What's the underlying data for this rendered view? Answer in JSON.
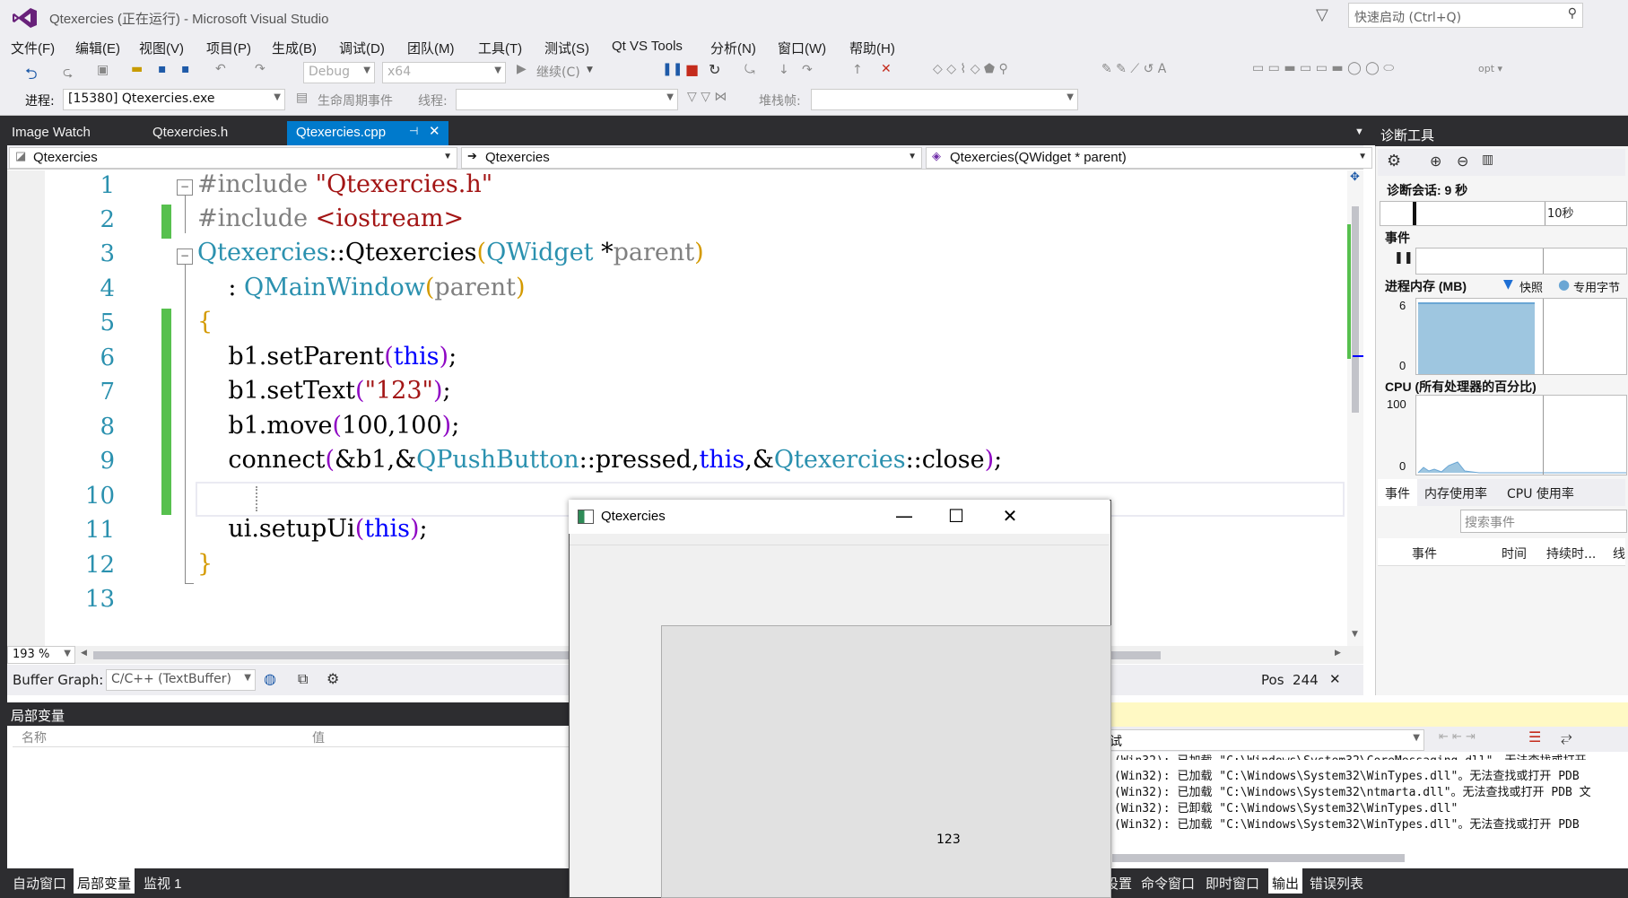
{
  "window": {
    "title": "Qtexercies (正在运行) - Microsoft Visual Studio",
    "quick_launch_placeholder": "快速启动 (Ctrl+Q)"
  },
  "menu": [
    "文件(F)",
    "编辑(E)",
    "视图(V)",
    "项目(P)",
    "生成(B)",
    "调试(D)",
    "团队(M)",
    "工具(T)",
    "测试(S)",
    "Qt VS Tools",
    "分析(N)",
    "窗口(W)",
    "帮助(H)"
  ],
  "toolbar": {
    "config": "Debug",
    "platform": "x64",
    "continue_label": "继续(C)",
    "process_label": "进程:",
    "process_value": "[15380] Qtexercies.exe",
    "lifecycle_label": "生命周期事件",
    "thread_label": "线程:",
    "stack_label": "堆栈帧:"
  },
  "doc_tabs": [
    "Image Watch",
    "Qtexercies.h",
    "Qtexercies.cpp"
  ],
  "nav": {
    "project": "Qtexercies",
    "scope": "Qtexercies",
    "member": "Qtexercies(QWidget * parent)"
  },
  "code": {
    "line_numbers": [
      "1",
      "2",
      "3",
      "4",
      "5",
      "6",
      "7",
      "8",
      "9",
      "10",
      "11",
      "12",
      "13"
    ]
  },
  "editor_footer": {
    "zoom": "193 %",
    "buffer_graph_label": "Buffer Graph:",
    "buffer_graph_value": "C/C++ (TextBuffer)",
    "pos": "Pos  244"
  },
  "diagnostics": {
    "title": "诊断工具",
    "session": "诊断会话: 9 秒",
    "tick_10s": "10秒",
    "events_label": "事件",
    "memory_label": "进程内存 (MB)",
    "snapshot_label": "快照",
    "private_bytes_label": "专用字节",
    "mem_max": "6",
    "mem_min": "0",
    "cpu_label": "CPU (所有处理器的百分比)",
    "cpu_max": "100",
    "cpu_min": "0",
    "tabs": [
      "事件",
      "内存使用率",
      "CPU 使用率"
    ],
    "search_placeholder": "搜索事件",
    "columns": [
      "事件",
      "时间",
      "持续时...",
      "线"
    ]
  },
  "locals": {
    "title": "局部变量",
    "col_name": "名称",
    "col_value": "值"
  },
  "output": {
    "source_tail": "试",
    "lines": [
      "(Win32): 已加载 \"C:\\Windows\\System32\\CoreMessaging.dll\"。无法查找或打开",
      "(Win32): 已加载 \"C:\\Windows\\System32\\WinTypes.dll\"。无法查找或打开 PDB",
      "(Win32): 已加载 \"C:\\Windows\\System32\\ntmarta.dll\"。无法查找或打开 PDB 文",
      "(Win32): 已卸载 \"C:\\Windows\\System32\\WinTypes.dll\"",
      "(Win32): 已加载 \"C:\\Windows\\System32\\WinTypes.dll\"。无法查找或打开 PDB"
    ]
  },
  "bottom_tabs_left": [
    "自动窗口",
    "局部变量",
    "监视 1"
  ],
  "bottom_tabs_right": [
    "设置",
    "命令窗口",
    "即时窗口",
    "输出",
    "错误列表"
  ],
  "qt_window": {
    "title": "Qtexercies",
    "button_text": "123"
  }
}
